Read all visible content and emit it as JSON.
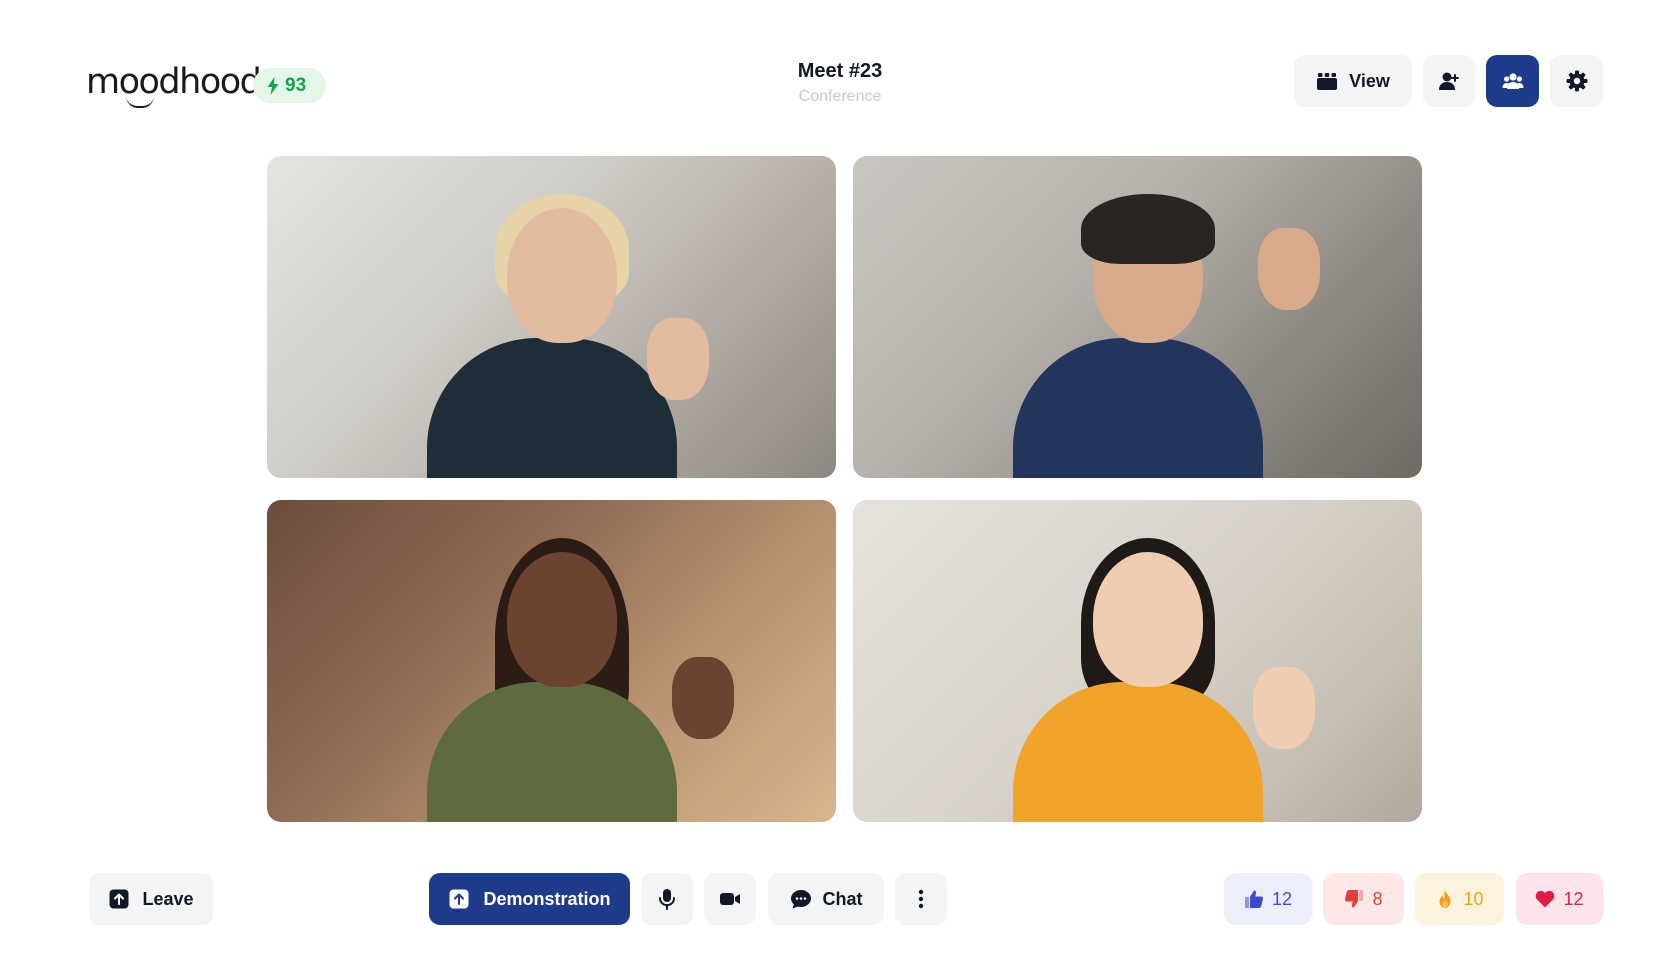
{
  "header": {
    "logo_text": "moodhood",
    "score": "93",
    "meeting_title": "Meet #23",
    "meeting_subtitle": "Conference",
    "view_label": "View"
  },
  "participants": [
    {
      "description": "woman-with-headphones"
    },
    {
      "description": "man-in-suit-waving"
    },
    {
      "description": "woman-taking-selfie"
    },
    {
      "description": "woman-in-yellow-waving"
    }
  ],
  "controls": {
    "leave_label": "Leave",
    "demo_label": "Demonstration",
    "chat_label": "Chat"
  },
  "reactions": {
    "like": "12",
    "dislike": "8",
    "fire": "10",
    "heart": "12"
  },
  "colors": {
    "accent": "#1e3a8a",
    "score_green": "#16a34a",
    "like": "#3b4bcb",
    "dislike": "#e53e3e",
    "fire": "#e8a317",
    "heart": "#e11d48"
  },
  "icons": [
    "bolt-icon",
    "grid-view-icon",
    "add-user-icon",
    "participants-icon",
    "settings-icon",
    "leave-icon",
    "demonstration-upload-icon",
    "microphone-icon",
    "video-camera-icon",
    "chat-bubble-icon",
    "more-vertical-icon",
    "thumbs-up-icon",
    "thumbs-down-icon",
    "fire-icon",
    "heart-icon"
  ]
}
